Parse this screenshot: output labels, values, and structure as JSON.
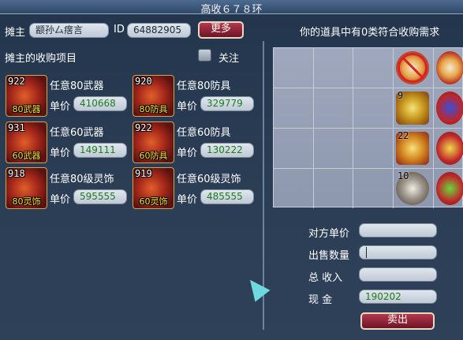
{
  "window": {
    "title": "高收６７８环"
  },
  "seller": {
    "label": "摊主",
    "name": "颛孙厶瘔言",
    "id_label": "ID",
    "id": "64882905",
    "more_button": "更多"
  },
  "purchase": {
    "heading": "摊主的收购项目",
    "follow_label": "关注",
    "price_label": "单价",
    "items": [
      {
        "name": "任意80武器",
        "count": "922",
        "tag": "80武器",
        "price": "410668"
      },
      {
        "name": "任意80防具",
        "count": "920",
        "tag": "80防具",
        "price": "329779"
      },
      {
        "name": "任意60武器",
        "count": "931",
        "tag": "60武器",
        "price": "149111"
      },
      {
        "name": "任意60防具",
        "count": "922",
        "tag": "60防具",
        "price": "130222"
      },
      {
        "name": "任意80级灵饰",
        "count": "918",
        "tag": "80灵饰",
        "price": "595555"
      },
      {
        "name": "任意60级灵饰",
        "count": "919",
        "tag": "60灵饰",
        "price": "485555"
      }
    ]
  },
  "inventory": {
    "heading": "你的道具中有0类符合收购需求",
    "items": [
      {
        "count": "",
        "icon": "medicine-icon",
        "blocked": true
      },
      {
        "count": "",
        "icon": "banner-icon",
        "blocked": true
      },
      {
        "count": "9",
        "icon": "treasure-box-icon",
        "blocked": false
      },
      {
        "count": "",
        "icon": "banner-icon",
        "blocked": true
      },
      {
        "count": "22",
        "icon": "firecracker-icon",
        "blocked": false
      },
      {
        "count": "",
        "icon": "banner-icon",
        "blocked": true
      },
      {
        "count": "10",
        "icon": "scroll-icon",
        "blocked": false
      },
      {
        "count": "",
        "icon": "banner-icon",
        "blocked": true
      }
    ]
  },
  "trade": {
    "unit_price_label": "对方单价",
    "unit_price_value": "",
    "quantity_label": "出售数量",
    "quantity_value": "",
    "total_label": "总 收入",
    "total_value": "",
    "cash_label": "现 金",
    "cash_value": "190202",
    "sell_button": "卖出"
  }
}
